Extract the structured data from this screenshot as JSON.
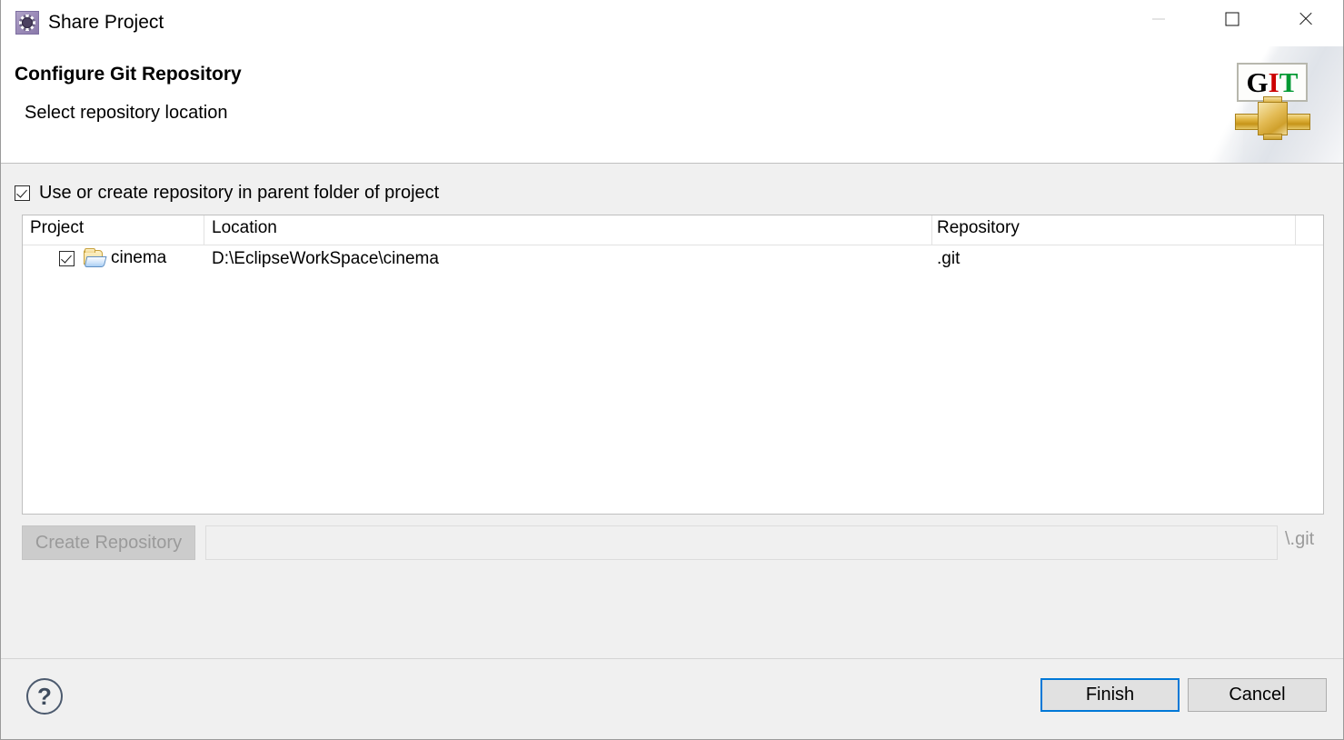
{
  "window": {
    "title": "Share Project",
    "icon": "gear-icon",
    "controls": {
      "minimize": "minimize-icon",
      "maximize": "maximize-icon",
      "close": "close-icon"
    }
  },
  "header": {
    "title": "Configure Git Repository",
    "subtitle": "Select repository location",
    "banner": {
      "letters": {
        "g": "G",
        "i": "I",
        "t": "T"
      },
      "colors": {
        "g": "#000000",
        "i": "#cc0000",
        "t": "#009933"
      }
    }
  },
  "options": {
    "parent_folder_checkbox": {
      "label": "Use or create repository in parent folder of project",
      "checked": true
    }
  },
  "table": {
    "columns": [
      "Project",
      "Location",
      "Repository"
    ],
    "rows": [
      {
        "checked": true,
        "icon": "folder-icon",
        "project": "cinema",
        "location": "D:\\EclipseWorkSpace\\cinema",
        "repository": ".git"
      }
    ]
  },
  "create_repository": {
    "button_label": "Create Repository",
    "button_enabled": false,
    "path_value": "",
    "path_placeholder": "",
    "suffix_label": "\\.git"
  },
  "footer": {
    "help_glyph": "?",
    "finish_label": "Finish",
    "cancel_label": "Cancel",
    "default_button": "Finish",
    "accent_color": "#0078d7"
  }
}
